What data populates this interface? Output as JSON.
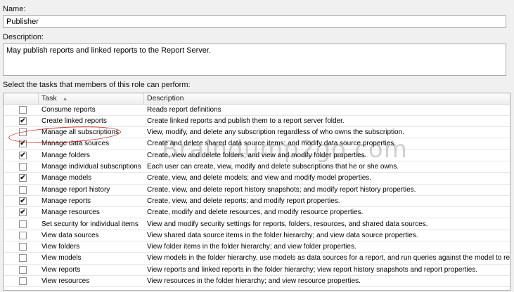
{
  "name": {
    "label": "Name:",
    "value": "Publisher"
  },
  "description": {
    "label": "Description:",
    "value": "May publish reports and linked reports to the Report Server."
  },
  "tasks_label": "Select the tasks that members of this role can perform:",
  "columns": {
    "task": "Task",
    "description": "Description"
  },
  "rows": [
    {
      "checked": false,
      "task": "Consume reports",
      "description": "Reads report definitions"
    },
    {
      "checked": true,
      "task": "Create linked reports",
      "description": "Create linked reports and publish them to a report server folder."
    },
    {
      "checked": false,
      "task": "Manage all subscriptions",
      "description": "View, modify, and delete any subscription regardless of who owns the subscription."
    },
    {
      "checked": true,
      "task": "Manage data sources",
      "description": "Create and delete shared data source items; and modify data source properties."
    },
    {
      "checked": true,
      "task": "Manage folders",
      "description": "Create, view and delete folders; and view and modify folder properties."
    },
    {
      "checked": false,
      "task": "Manage individual subscriptions",
      "description": "Each user can create, view, modify and delete subscriptions that he or she owns."
    },
    {
      "checked": true,
      "task": "Manage models",
      "description": "Create, view, and delete models; and view and modify model properties."
    },
    {
      "checked": false,
      "task": "Manage report history",
      "description": "Create, view, and delete report history snapshots; and modify report history properties."
    },
    {
      "checked": true,
      "task": "Manage reports",
      "description": "Create, view, and delete reports; and modify report properties."
    },
    {
      "checked": true,
      "task": "Manage resources",
      "description": "Create, modify and delete resources, and modify resource properties."
    },
    {
      "checked": false,
      "task": "Set security for individual items",
      "description": "View and modify security settings for reports, folders, resources, and shared data sources."
    },
    {
      "checked": false,
      "task": "View data sources",
      "description": "View shared data source items in the folder hierarchy; and view data source properties."
    },
    {
      "checked": false,
      "task": "View folders",
      "description": "View folder items in the folder hierarchy; and view folder properties."
    },
    {
      "checked": false,
      "task": "View models",
      "description": "View models in the folder hierarchy, use models as data sources for a report, and run queries against the model to retrieve data."
    },
    {
      "checked": false,
      "task": "View reports",
      "description": "View reports and linked reports in the folder hierarchy; view report history snapshots and report properties."
    },
    {
      "checked": false,
      "task": "View resources",
      "description": "View resources in the folder hierarchy; and view resource properties."
    }
  ],
  "watermark": "Braindump2go.com",
  "icons": {
    "check": "checkmark-icon",
    "sort": "sort-ascending-icon"
  }
}
